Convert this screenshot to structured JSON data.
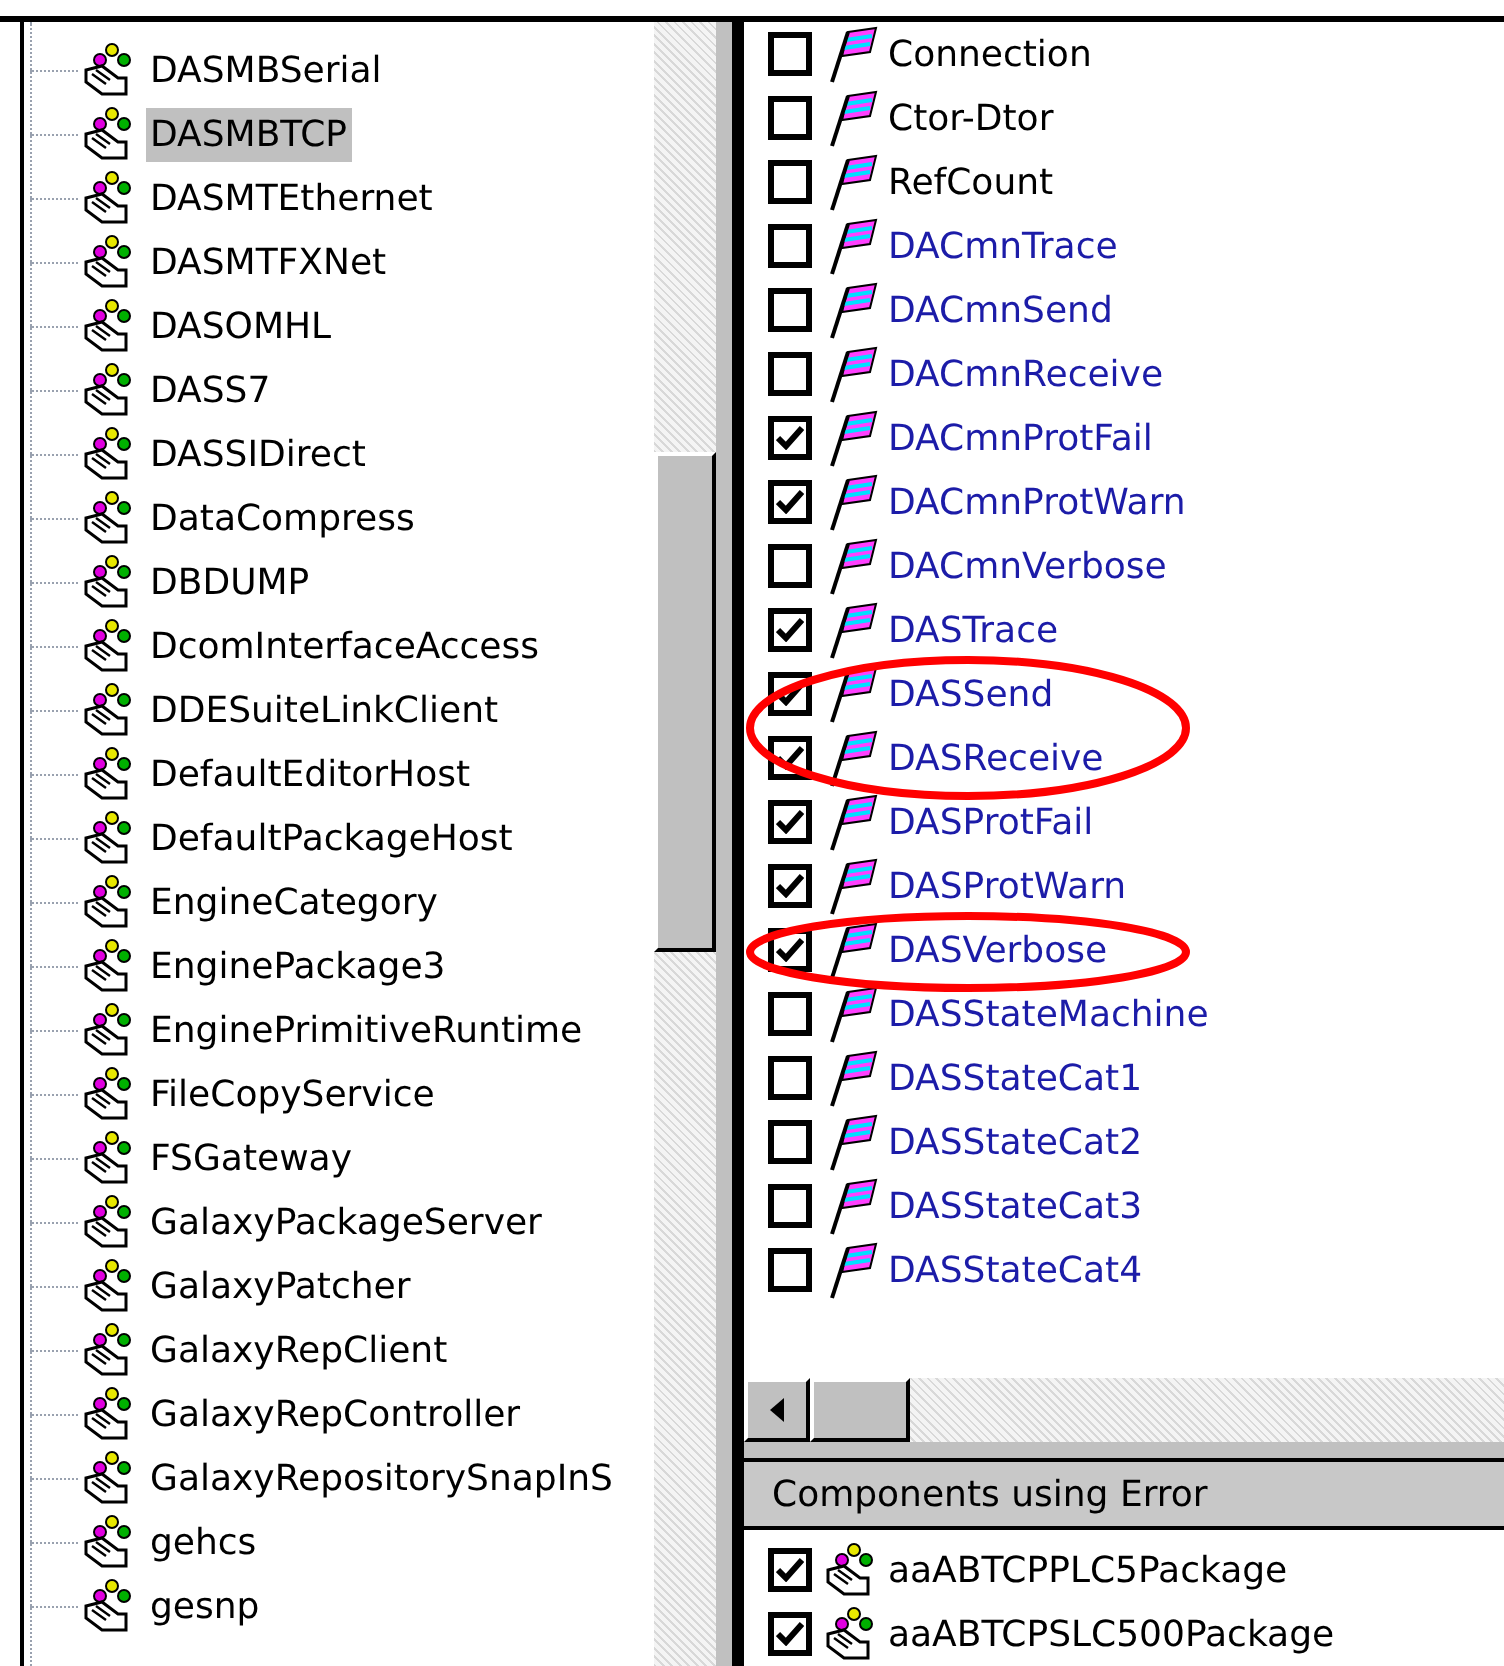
{
  "tree": {
    "items": [
      {
        "label": "DASMBSerial",
        "selected": false
      },
      {
        "label": "DASMBTCP",
        "selected": true
      },
      {
        "label": "DASMTEthernet",
        "selected": false
      },
      {
        "label": "DASMTFXNet",
        "selected": false
      },
      {
        "label": "DASOMHL",
        "selected": false
      },
      {
        "label": "DASS7",
        "selected": false
      },
      {
        "label": "DASSIDirect",
        "selected": false
      },
      {
        "label": "DataCompress",
        "selected": false
      },
      {
        "label": "DBDUMP",
        "selected": false
      },
      {
        "label": "DcomInterfaceAccess",
        "selected": false
      },
      {
        "label": "DDESuiteLinkClient",
        "selected": false
      },
      {
        "label": "DefaultEditorHost",
        "selected": false
      },
      {
        "label": "DefaultPackageHost",
        "selected": false
      },
      {
        "label": "EngineCategory",
        "selected": false
      },
      {
        "label": "EnginePackage3",
        "selected": false
      },
      {
        "label": "EnginePrimitiveRuntime",
        "selected": false
      },
      {
        "label": "FileCopyService",
        "selected": false
      },
      {
        "label": "FSGateway",
        "selected": false
      },
      {
        "label": "GalaxyPackageServer",
        "selected": false
      },
      {
        "label": "GalaxyPatcher",
        "selected": false
      },
      {
        "label": "GalaxyRepClient",
        "selected": false
      },
      {
        "label": "GalaxyRepController",
        "selected": false
      },
      {
        "label": "GalaxyRepositorySnapInS",
        "selected": false
      },
      {
        "label": "gehcs",
        "selected": false
      },
      {
        "label": "gesnp",
        "selected": false
      }
    ]
  },
  "log_flags": {
    "items": [
      {
        "label": "Connection",
        "kind": "standard",
        "checked": false,
        "circled": false
      },
      {
        "label": "Ctor-Dtor",
        "kind": "standard",
        "checked": false,
        "circled": false
      },
      {
        "label": "RefCount",
        "kind": "standard",
        "checked": false,
        "circled": false
      },
      {
        "label": "DACmnTrace",
        "kind": "custom",
        "checked": false,
        "circled": false
      },
      {
        "label": "DACmnSend",
        "kind": "custom",
        "checked": false,
        "circled": false
      },
      {
        "label": "DACmnReceive",
        "kind": "custom",
        "checked": false,
        "circled": false
      },
      {
        "label": "DACmnProtFail",
        "kind": "custom",
        "checked": true,
        "circled": false
      },
      {
        "label": "DACmnProtWarn",
        "kind": "custom",
        "checked": true,
        "circled": false
      },
      {
        "label": "DACmnVerbose",
        "kind": "custom",
        "checked": false,
        "circled": false
      },
      {
        "label": "DASTrace",
        "kind": "custom",
        "checked": true,
        "circled": false
      },
      {
        "label": "DASSend",
        "kind": "custom",
        "checked": true,
        "circled": true
      },
      {
        "label": "DASReceive",
        "kind": "custom",
        "checked": true,
        "circled": true
      },
      {
        "label": "DASProtFail",
        "kind": "custom",
        "checked": true,
        "circled": false
      },
      {
        "label": "DASProtWarn",
        "kind": "custom",
        "checked": true,
        "circled": false
      },
      {
        "label": "DASVerbose",
        "kind": "custom",
        "checked": true,
        "circled": true
      },
      {
        "label": "DASStateMachine",
        "kind": "custom",
        "checked": false,
        "circled": false
      },
      {
        "label": "DASStateCat1",
        "kind": "custom",
        "checked": false,
        "circled": false
      },
      {
        "label": "DASStateCat2",
        "kind": "custom",
        "checked": false,
        "circled": false
      },
      {
        "label": "DASStateCat3",
        "kind": "custom",
        "checked": false,
        "circled": false
      },
      {
        "label": "DASStateCat4",
        "kind": "custom",
        "checked": false,
        "circled": false
      }
    ]
  },
  "components": {
    "header": "Components using Error",
    "items": [
      {
        "label": "aaABTCPPLC5Package",
        "checked": true
      },
      {
        "label": "aaABTCPSLC500Package",
        "checked": true
      }
    ]
  }
}
